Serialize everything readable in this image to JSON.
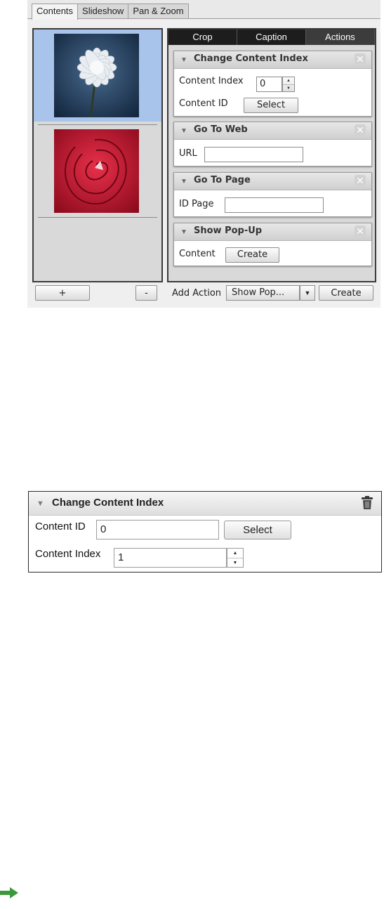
{
  "tabs": [
    "Contents",
    "Slideshow",
    "Pan & Zoom"
  ],
  "active_tab": "Contents",
  "content_list": {
    "items": [
      {
        "image": "white-chrysanthemum-thumbnail",
        "selected": true
      },
      {
        "image": "red-rose-thumbnail",
        "selected": false
      }
    ],
    "add_label": "+",
    "remove_label": "-"
  },
  "subtabs": [
    "Crop",
    "Caption",
    "Actions"
  ],
  "active_subtab": "Actions",
  "actions": {
    "change_content_index": {
      "title": "Change Content Index",
      "content_index_label": "Content Index",
      "content_index_value": "0",
      "content_id_label": "Content ID",
      "select_label": "Select"
    },
    "go_to_web": {
      "title": "Go To Web",
      "url_label": "URL",
      "url_value": ""
    },
    "go_to_page": {
      "title": "Go To Page",
      "id_page_label": "ID Page",
      "id_page_value": ""
    },
    "show_popup": {
      "title": "Show Pop-Up",
      "content_label": "Content",
      "create_label": "Create"
    }
  },
  "add_action": {
    "label": "Add Action",
    "selected": "Show Pop...",
    "create_label": "Create"
  },
  "widget2": {
    "title": "Change Content Index",
    "content_id_label": "Content ID",
    "content_id_value": "0",
    "select_label": "Select",
    "content_index_label": "Content Index",
    "content_index_value": "1"
  },
  "icons": {
    "collapse": "triangle-down-icon",
    "close": "close-x-icon",
    "delete": "trash-icon",
    "arrow": "green-right-arrow-icon"
  },
  "colors": {
    "selection": "#a9c4ea",
    "subtab_bar": "#1d1d1d",
    "arrow": "#3a9a3a"
  }
}
